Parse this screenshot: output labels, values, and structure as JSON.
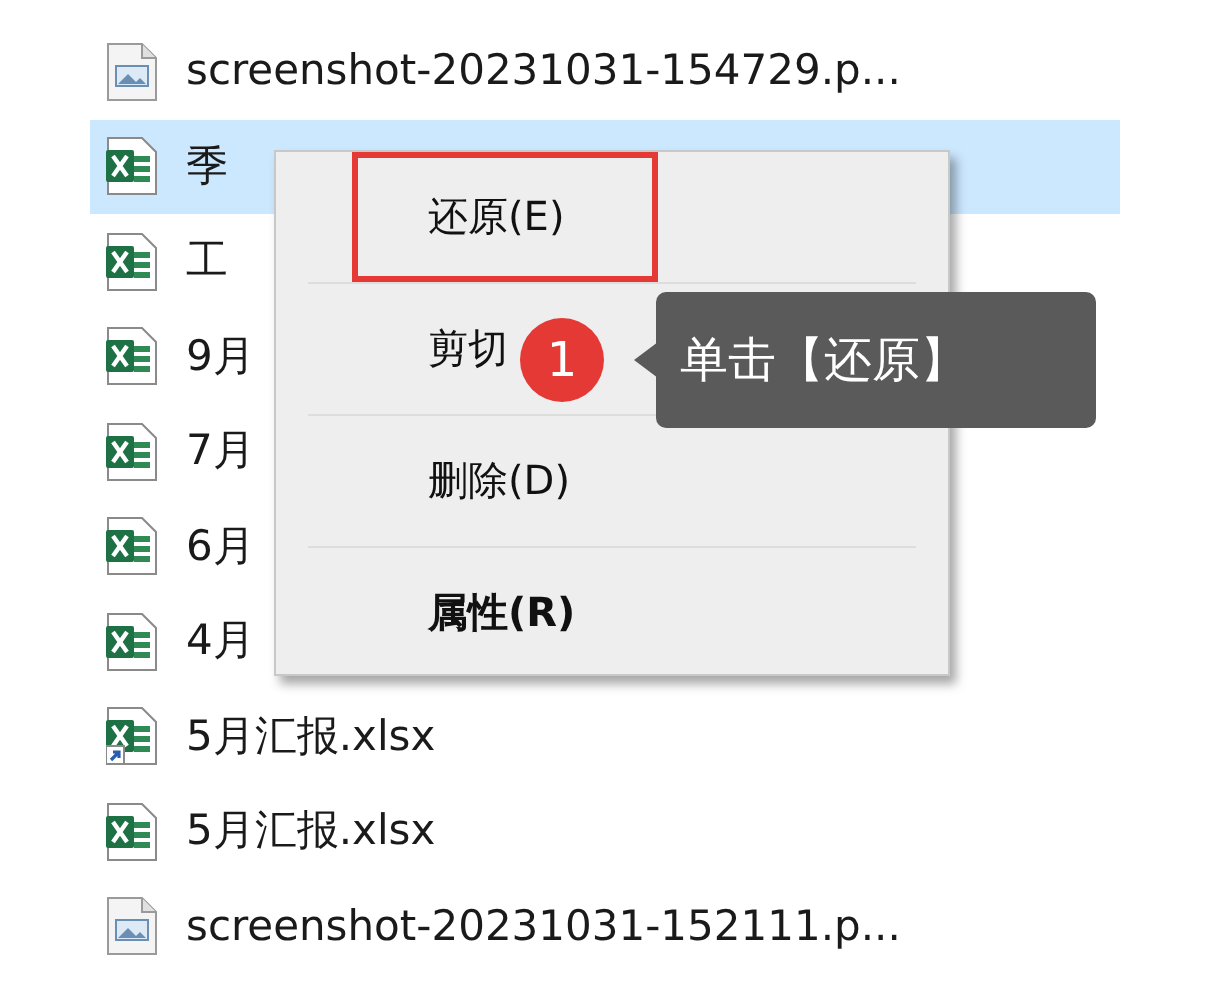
{
  "files": [
    {
      "kind": "image",
      "name": "screenshot-20231031-154729.p...",
      "selected": false
    },
    {
      "kind": "excel",
      "name": "季",
      "selected": true
    },
    {
      "kind": "excel",
      "name": "工",
      "selected": false
    },
    {
      "kind": "excel",
      "name": "9月",
      "selected": false
    },
    {
      "kind": "excel",
      "name": "7月",
      "selected": false
    },
    {
      "kind": "excel",
      "name": "6月",
      "selected": false
    },
    {
      "kind": "excel",
      "name": "4月",
      "selected": false
    },
    {
      "kind": "excel-shortcut",
      "name": "5月汇报.xlsx",
      "selected": false
    },
    {
      "kind": "excel",
      "name": "5月汇报.xlsx",
      "selected": false
    },
    {
      "kind": "image",
      "name": "screenshot-20231031-152111.p...",
      "selected": false
    }
  ],
  "context_menu": {
    "items": [
      {
        "label": "还原(E)",
        "bold": false,
        "highlighted": true
      },
      {
        "label": "剪切",
        "bold": false,
        "highlighted": false
      },
      {
        "label": "删除(D)",
        "bold": false,
        "highlighted": false
      },
      {
        "label": "属性(R)",
        "bold": true,
        "highlighted": false
      }
    ]
  },
  "callout": {
    "number": "1",
    "text": "单击【还原】"
  }
}
